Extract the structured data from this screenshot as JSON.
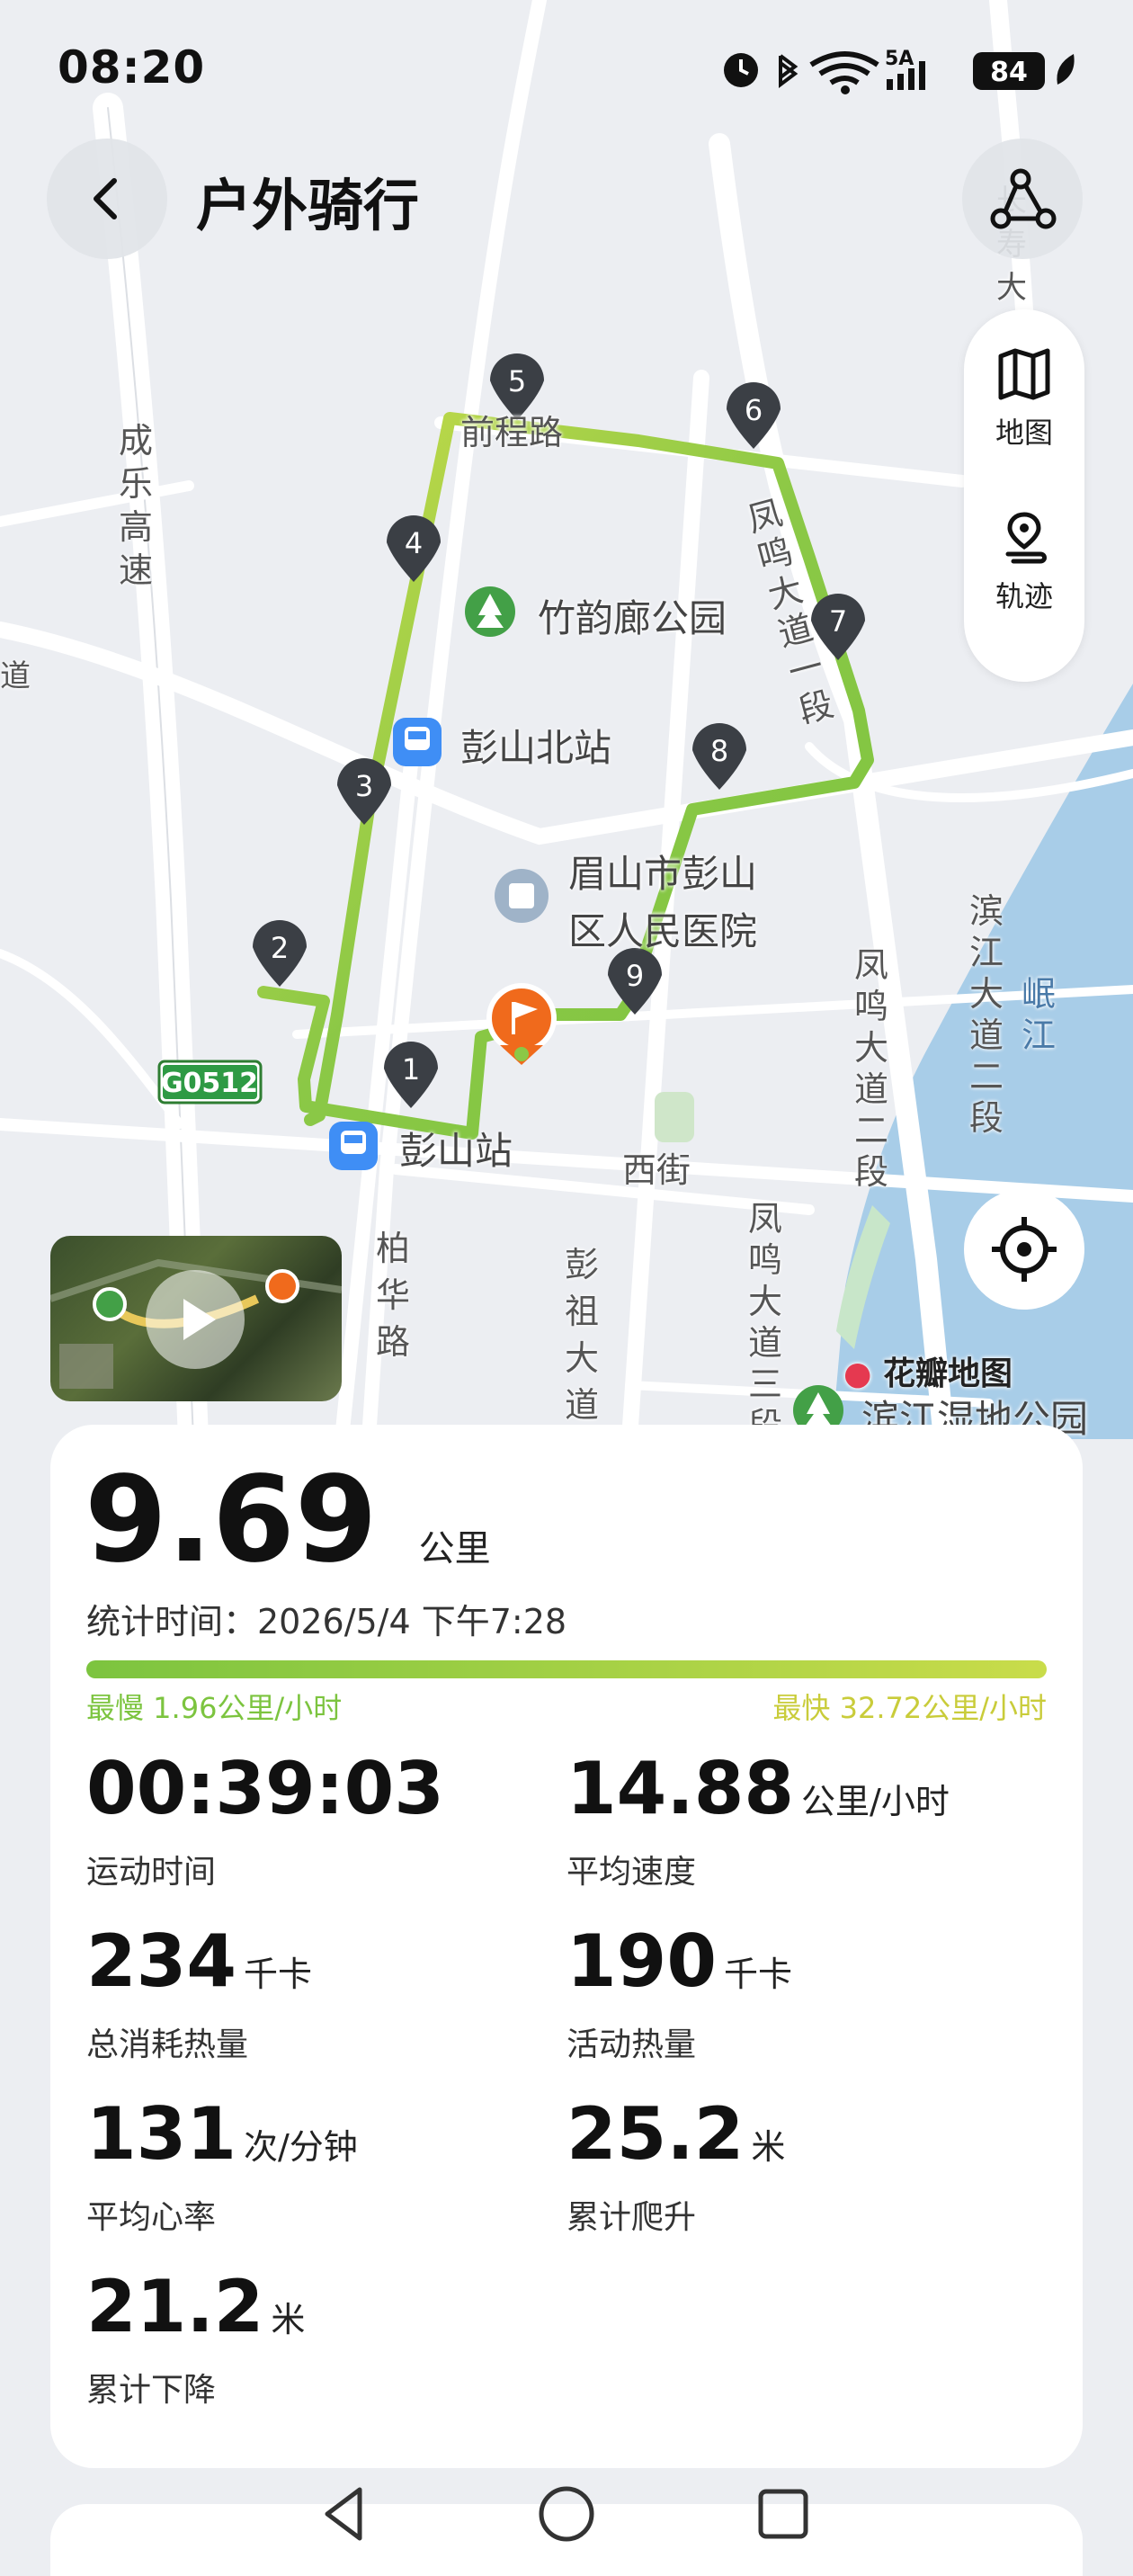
{
  "status_bar": {
    "time": "08:20",
    "network": "5A",
    "battery": "84"
  },
  "header": {
    "title": "户外骑行"
  },
  "side_panel": {
    "map_label": "地图",
    "track_label": "轨迹"
  },
  "map": {
    "roads": [
      "成乐高速",
      "前程路",
      "凤鸣大道一段",
      "凤鸣大道二段",
      "凤鸣大道三段",
      "滨江大道二段",
      "彭祖大道",
      "柏华路",
      "西街",
      "长寿大道",
      "道"
    ],
    "pois": [
      "竹韵廊公园",
      "彭山北站",
      "眉山市彭山区人民医院",
      "彭山站",
      "滨江湿地公园"
    ],
    "poi_lines": {
      "hospital_1": "眉山市彭山",
      "hospital_2": "区人民医院"
    },
    "highway_shield": "G0512",
    "river": "岷江",
    "watermark": "花瓣地图",
    "km_markers": [
      "1",
      "2",
      "3",
      "4",
      "5",
      "6",
      "7",
      "8",
      "9"
    ],
    "route_colors": {
      "slow": "#7cc43f",
      "fast": "#c9dc4a"
    }
  },
  "stats": {
    "distance": "9.69",
    "distance_unit": "公里",
    "record_time": "统计时间：2026/5/4 下午7:28",
    "slowest": "最慢 1.96公里/小时",
    "fastest": "最快 32.72公里/小时",
    "items": [
      {
        "value": "00:39:03",
        "unit": "",
        "label": "运动时间"
      },
      {
        "value": "14.88",
        "unit": "公里/小时",
        "label": "平均速度"
      },
      {
        "value": "234",
        "unit": "千卡",
        "label": "总消耗热量"
      },
      {
        "value": "190",
        "unit": "千卡",
        "label": "活动热量"
      },
      {
        "value": "131",
        "unit": "次/分钟",
        "label": "平均心率"
      },
      {
        "value": "25.2",
        "unit": "米",
        "label": "累计爬升"
      },
      {
        "value": "21.2",
        "unit": "米",
        "label": "累计下降"
      }
    ]
  }
}
